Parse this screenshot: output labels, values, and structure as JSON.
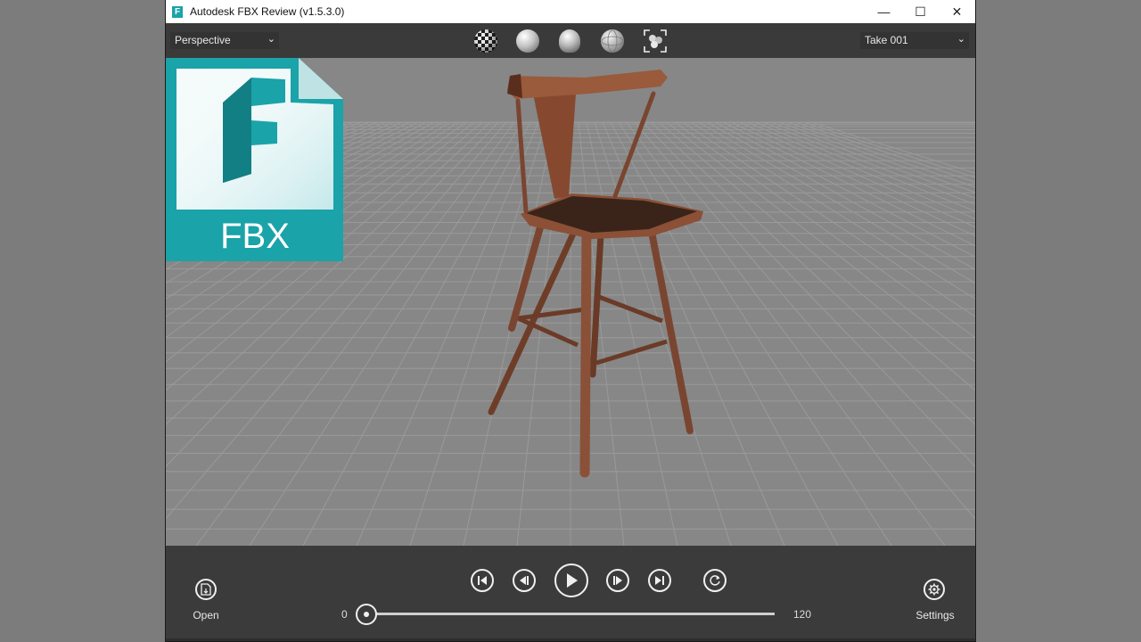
{
  "window": {
    "title": "Autodesk FBX Review (v1.5.3.0)",
    "app_icon_letter": "F",
    "controls": {
      "minimize": "—",
      "maximize": "☐",
      "close": "✕"
    }
  },
  "toolbar": {
    "camera_select": "Perspective",
    "take_select": "Take 001",
    "view_modes": [
      "checker-shading-icon",
      "smooth-shading-icon",
      "light-icon",
      "wireframe-shading-icon",
      "frame-all-icon"
    ]
  },
  "logo": {
    "text": "FBX",
    "letter": "F"
  },
  "playback": {
    "open_label": "Open",
    "settings_label": "Settings",
    "start_frame": "0",
    "end_frame": "120",
    "current_position": 0.0,
    "buttons": [
      "first-frame-icon",
      "previous-frame-icon",
      "play-icon",
      "next-frame-icon",
      "last-frame-icon",
      "loop-icon"
    ]
  },
  "colors": {
    "toolbar_bg": "#3a3a3a",
    "viewport_bg": "#878787",
    "grid_line": "#9a9a9a",
    "chair_wood": "#7a4530",
    "logo_teal": "#1aa3a8"
  }
}
